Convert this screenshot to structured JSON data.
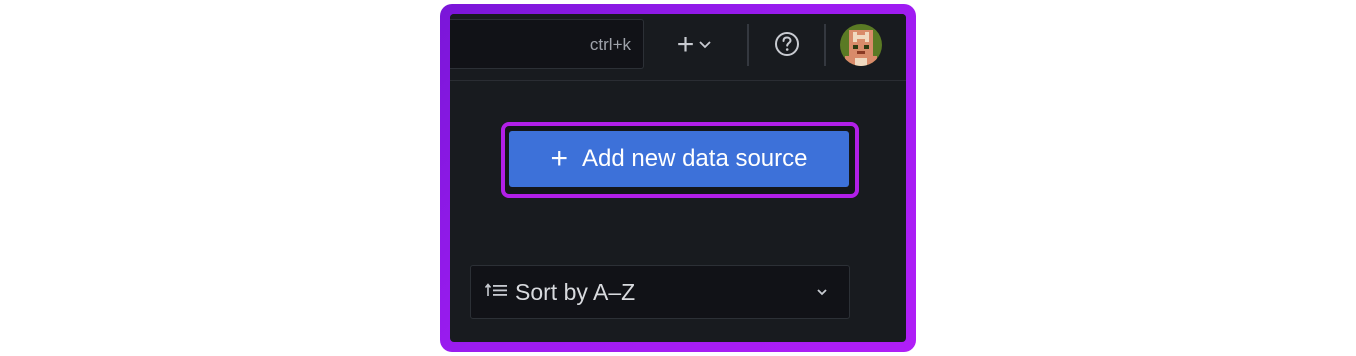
{
  "topbar": {
    "search": {
      "shortcut_hint": "ctrl+k"
    },
    "new_menu": {
      "icon": "plus-icon",
      "chevron": "chevron-down-icon"
    },
    "help": {
      "icon": "help-circle-icon"
    },
    "profile": {
      "icon": "avatar"
    }
  },
  "main": {
    "add_button": {
      "icon": "plus-icon",
      "label": "Add new data source"
    },
    "sort": {
      "icon": "sort-ascending-icon",
      "selected": "Sort by A–Z"
    }
  },
  "colors": {
    "highlight": "#b21fe8",
    "primary_button": "#3d71d9",
    "panel_bg": "#181b1f"
  }
}
